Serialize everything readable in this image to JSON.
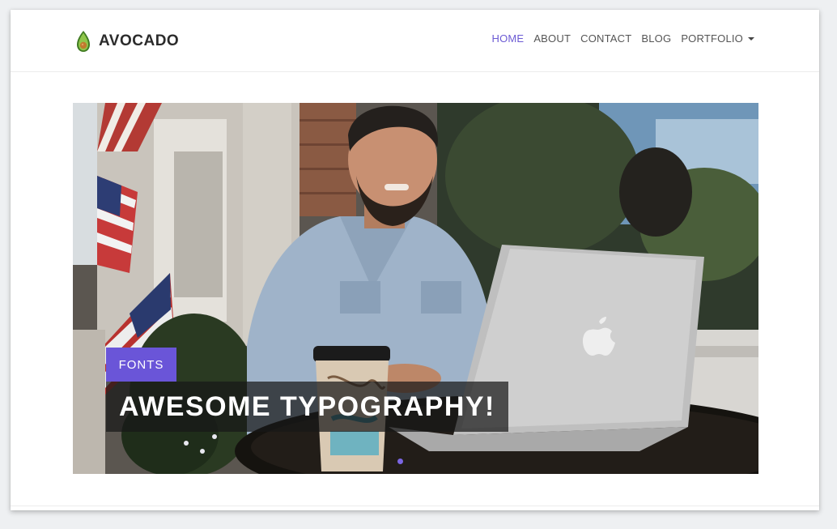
{
  "brand": {
    "name": "AVOCADO",
    "logo_icon": "avocado-icon"
  },
  "nav": {
    "items": [
      {
        "label": "HOME",
        "active": true
      },
      {
        "label": "ABOUT",
        "active": false
      },
      {
        "label": "CONTACT",
        "active": false
      },
      {
        "label": "BLOG",
        "active": false
      },
      {
        "label": "PORTFOLIO",
        "active": false,
        "dropdown": true
      }
    ]
  },
  "hero": {
    "tag": "FONTS",
    "title": "AWESOME TYPOGRAPHY!",
    "slide_count": 1,
    "active_slide": 1
  },
  "colors": {
    "accent": "#6a55d8",
    "nav_active": "#6c5bd4",
    "nav_text": "#555555",
    "brand_text": "#2b2b2b",
    "caption_bg": "rgba(24,24,24,0.72)"
  }
}
